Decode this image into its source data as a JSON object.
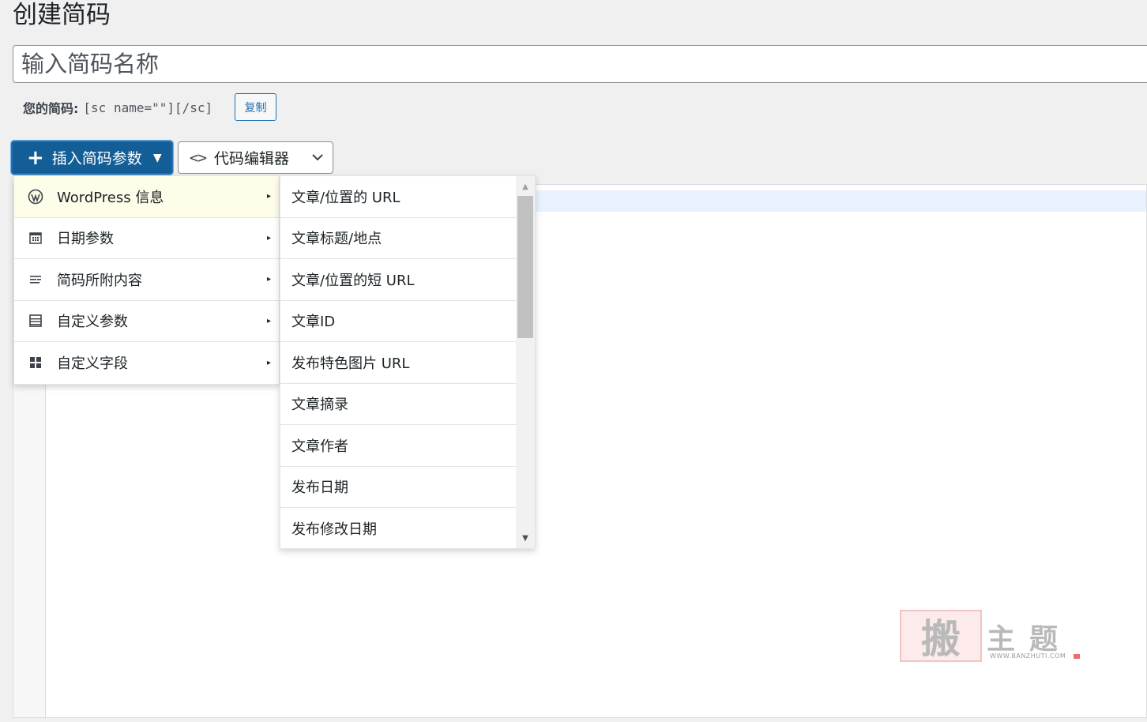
{
  "page": {
    "title": "创建简码"
  },
  "name_input": {
    "placeholder": "输入简码名称",
    "value": ""
  },
  "shortcode": {
    "label": "您的简码:",
    "code": "[sc name=\"\"][/sc]",
    "copy_label": "复制"
  },
  "toolbar": {
    "insert_label": "插入简码参数",
    "code_editor_label": "代码编辑器"
  },
  "menu": {
    "items": [
      {
        "label": "WordPress 信息",
        "icon": "wordpress-icon",
        "active": true
      },
      {
        "label": "日期参数",
        "icon": "calendar-icon",
        "active": false
      },
      {
        "label": "简码所附内容",
        "icon": "text-align-icon",
        "active": false
      },
      {
        "label": "自定义参数",
        "icon": "list-view-icon",
        "active": false
      },
      {
        "label": "自定义字段",
        "icon": "grid-icon",
        "active": false
      }
    ],
    "submenu": [
      "文章/位置的 URL",
      "文章标题/地点",
      "文章/位置的短 URL",
      "文章ID",
      "发布特色图片 URL",
      "文章摘录",
      "文章作者",
      "发布日期",
      "发布修改日期"
    ]
  },
  "watermark": {
    "stamp": "搬",
    "title": "主题",
    "url": "WWW.BANZHUTI.COM"
  },
  "colors": {
    "primary": "#135e96",
    "accent": "#2271b1",
    "active_menu_bg": "#fefde9",
    "editor_active_line": "#e8f2ff"
  }
}
